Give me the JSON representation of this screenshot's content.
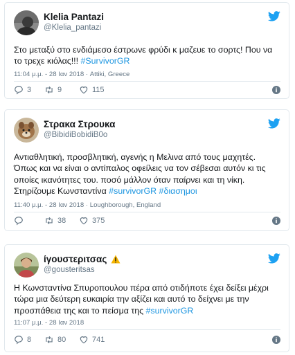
{
  "colors": {
    "accent": "#1da1f2",
    "hashtag": "#1b95e0",
    "muted": "#657786",
    "border": "#e1e8ed"
  },
  "tweets": [
    {
      "name": "Klelia Pantazi",
      "handle": "@Klelia_pantazi",
      "text": "Στο μεταξύ στο ενδιάμεσο έστρωνε φρύδι κ μαζευε το σορτς! Που να το τρεχε κιόλας!!!",
      "hashtags": [
        "#SurvivorGR"
      ],
      "meta": "11:04 μ.μ. - 28 Ιαν 2018 · Attiki, Greece",
      "replies": "3",
      "retweets": "9",
      "likes": "115"
    },
    {
      "name": "Στρακα Στρουκα",
      "handle": "@BibidiBobidiB0o",
      "text": "Αντιαθλητική, προσβλητική, αγενής η Μελινα από τους μαχητές. Όπως και να είναι ο αντίπαλος οφείλεις να τον σέβεσαι αυτόν κι τις οποίες ικανότητες του. ποσό μάλλον όταν παίρνει και τη νίκη. Στηρίζουμε Κωνσταντίνα",
      "hashtags": [
        "#survivorGR",
        "#διασημοι"
      ],
      "meta": "11:40 μ.μ. - 28 Ιαν 2018 · Loughborough, England",
      "replies": "",
      "retweets": "38",
      "likes": "375"
    },
    {
      "name": "ίγουστεριτσας",
      "handle": "@gousteritsas",
      "text": "Η Κωνσταντίνα Σπυροπουλου πέρα από οτιδήποτε έχει δείξει μέχρι τώρα μια δεύτερη ευκαιρία την αξίζει και αυτό το δείχνει με την προσπάθεια της και το πείσμα της",
      "hashtags": [
        "#survivorGR"
      ],
      "meta": "11:07 μ.μ. - 28 Ιαν 2018",
      "replies": "8",
      "retweets": "80",
      "likes": "741"
    }
  ],
  "icons": {
    "brand": "twitter-bird-icon",
    "reply": "reply-icon",
    "retweet": "retweet-icon",
    "like": "heart-icon",
    "info": "info-icon",
    "warning": "warning-icon"
  }
}
